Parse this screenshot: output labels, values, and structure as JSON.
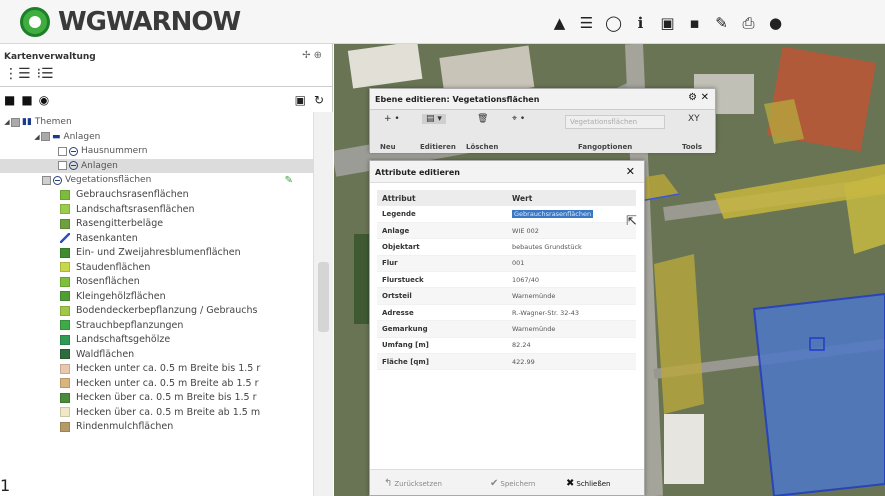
{
  "header": {
    "logo_text": "WGWARNOW",
    "toolbar_icons": [
      "measure-icon",
      "layers-list-icon",
      "comment-icon",
      "info-icon",
      "save-view-icon",
      "floppy-icon",
      "pencil-icon",
      "print-icon",
      "globe-icon"
    ]
  },
  "left_panel": {
    "title": "Kartenverwaltung",
    "tree": {
      "themen": "Themen",
      "anlagen_group": "Anlagen",
      "hausnummern": "Hausnummern",
      "anlagen": "Anlagen",
      "vegetation": "Vegetationsflächen"
    },
    "legend": [
      {
        "label": "Gebrauchsrasenflächen",
        "color": "#7dbb3c"
      },
      {
        "label": "Landschaftsrasenflächen",
        "color": "#9acd4c"
      },
      {
        "label": "Rasengitterbeläge",
        "color": "#6fa040"
      },
      {
        "label": "Rasenkanten",
        "color": "#2f4fc4"
      },
      {
        "label": "Ein- und Zweijahresblumenflächen",
        "color": "#3f8c2f"
      },
      {
        "label": "Staudenflächen",
        "color": "#c8d84a"
      },
      {
        "label": "Rosenflächen",
        "color": "#7ec03a"
      },
      {
        "label": "Kleingehölzflächen",
        "color": "#4f9e35"
      },
      {
        "label": "Bodendeckerbepflanzung / Gebrauchs",
        "color": "#a0c846"
      },
      {
        "label": "Strauchbepflanzungen",
        "color": "#3faa48"
      },
      {
        "label": "Landschaftsgehölze",
        "color": "#2f9a55"
      },
      {
        "label": "Waldflächen",
        "color": "#2e6b3e"
      },
      {
        "label": "Hecken unter ca. 0.5 m Breite bis 1.5 r",
        "color": "#e8c9b0"
      },
      {
        "label": "Hecken unter ca. 0.5 m Breite ab 1.5 r",
        "color": "#d9b47c"
      },
      {
        "label": "Hecken über ca. 0.5 m Breite bis 1.5 r",
        "color": "#4a8c3a"
      },
      {
        "label": "Hecken über ca. 0.5 m Breite ab 1.5 m",
        "color": "#f0e8c6"
      },
      {
        "label": "Rindenmulchflächen",
        "color": "#b59a68"
      }
    ]
  },
  "edit_dialog": {
    "title": "Ebene editieren: Vegetationsflächen",
    "buttons": [
      {
        "icon": "new-icon",
        "label": "Neu"
      },
      {
        "icon": "edit-icon",
        "label": "Editieren"
      },
      {
        "icon": "trash-icon",
        "label": "Löschen"
      }
    ],
    "snap_label": "Fangoptionen",
    "snap_placeholder": "Vegetationsflächen",
    "tools_label": "Tools",
    "tools_value": "XY"
  },
  "attr_dialog": {
    "title": "Attribute editieren",
    "col_attribute": "Attribut",
    "col_value": "Wert",
    "rows": [
      {
        "k": "Legende",
        "v": "Gebrauchsrasenflächen"
      },
      {
        "k": "Anlage",
        "v": "WIE 002"
      },
      {
        "k": "Objektart",
        "v": "bebautes Grundstück"
      },
      {
        "k": "Flur",
        "v": "001"
      },
      {
        "k": "Flurstueck",
        "v": "1067/40"
      },
      {
        "k": "Ortsteil",
        "v": "Warnemünde"
      },
      {
        "k": "Adresse",
        "v": "R.-Wagner-Str. 32-43"
      },
      {
        "k": "Gemarkung",
        "v": "Warnemünde"
      },
      {
        "k": "Umfang [m]",
        "v": "82.24"
      },
      {
        "k": "Fläche [qm]",
        "v": "422.99"
      }
    ],
    "footer": {
      "reset": "Zurücksetzen",
      "save": "Speichern",
      "close": "Schließen"
    }
  },
  "page_number": "1"
}
